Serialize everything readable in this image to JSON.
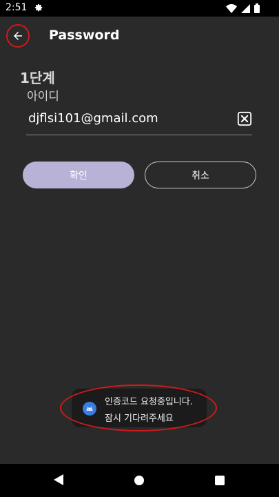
{
  "status_bar": {
    "time": "2:51",
    "icons": [
      "gear-icon",
      "wifi-icon",
      "signal-icon",
      "battery-icon"
    ]
  },
  "app_bar": {
    "title": "Password",
    "back_icon": "arrow-left-icon"
  },
  "form": {
    "step_label": "1단계",
    "id_label": "아이디",
    "id_value": "djflsi101@gmail.com",
    "clear_icon": "clear-box-icon"
  },
  "buttons": {
    "confirm_label": "확인",
    "cancel_label": "취소"
  },
  "toast": {
    "line1": "인증코드 요청중입니다.",
    "line2": "잠시 기다려주세요",
    "icon": "android-app-icon"
  },
  "colors": {
    "background": "#2a2a2a",
    "accent": "#b7b2d6",
    "highlight": "#d11a1a"
  },
  "nav_bar": {
    "icons": [
      "back-triangle-icon",
      "home-circle-icon",
      "recents-square-icon"
    ]
  }
}
